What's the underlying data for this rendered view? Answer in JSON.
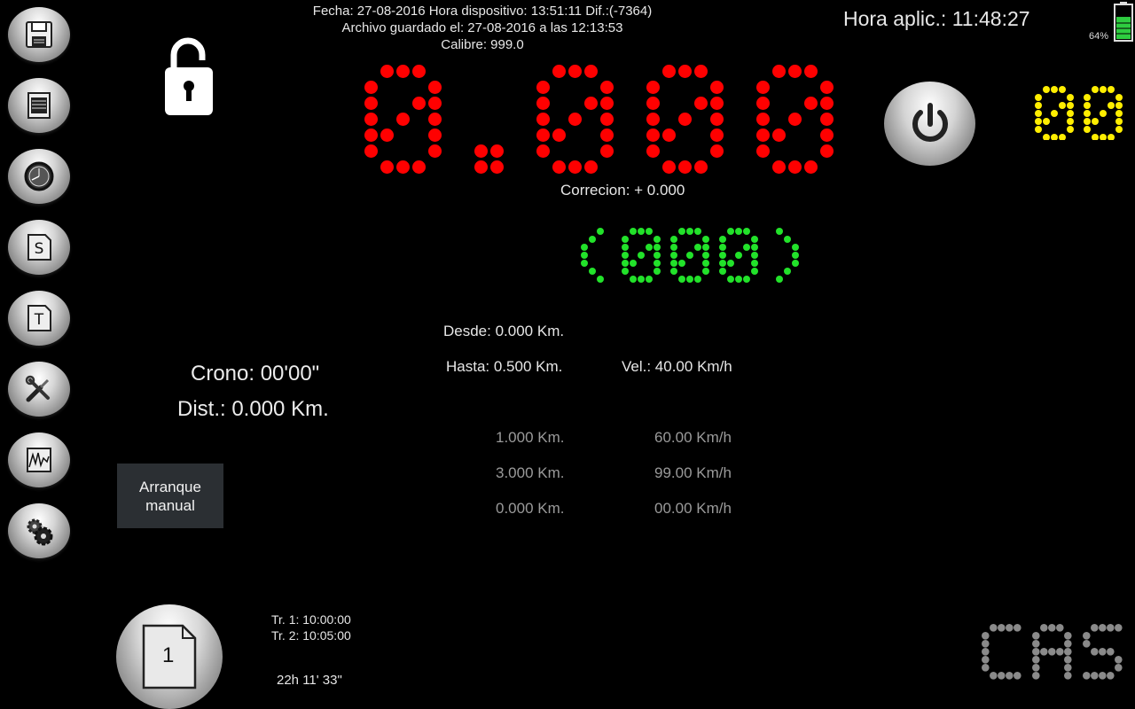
{
  "header": {
    "line1": "Fecha: 27-08-2016 Hora dispositivo: 13:51:11 Dif.:(-7364)",
    "line2": "Archivo guardado el: 27-08-2016 a las 12:13:53",
    "line3": "Calibre: 999.0"
  },
  "clock": "Hora aplic.: 11:48:27",
  "battery": {
    "percent": "64%",
    "level": 0.64,
    "color": "#2ecc40"
  },
  "sidebar": {
    "items": [
      {
        "name": "save",
        "icon": "floppy-icon"
      },
      {
        "name": "document",
        "icon": "document-icon"
      },
      {
        "name": "clock",
        "icon": "clock-icon"
      },
      {
        "name": "s-file",
        "icon": "s-file-icon",
        "letter": "S"
      },
      {
        "name": "t-file",
        "icon": "t-file-icon",
        "letter": "T"
      },
      {
        "name": "tools",
        "icon": "tools-icon"
      },
      {
        "name": "chart",
        "icon": "chart-icon"
      },
      {
        "name": "settings",
        "icon": "gears-icon"
      }
    ]
  },
  "displays": {
    "main_value": "0.000",
    "main_color": "#ff0000",
    "secondary_value": "(000)",
    "secondary_color": "#22e22a",
    "corner_value": "00",
    "corner_color": "#ffee00",
    "logo_text": "CAS",
    "logo_color": "#8a8a8a"
  },
  "correction": "Correcion: + 0.000",
  "segment": {
    "desde": "Desde: 0.000 Km.",
    "hasta": "Hasta: 0.500 Km.",
    "vel": "Vel.: 40.00 Km/h"
  },
  "upcoming": [
    {
      "km": "1.000 Km.",
      "speed": "60.00 Km/h"
    },
    {
      "km": "3.000 Km.",
      "speed": "99.00 Km/h"
    },
    {
      "km": "0.000 Km.",
      "speed": "00.00 Km/h"
    }
  ],
  "crono": "Crono: 00'00\"",
  "dist": "Dist.: 0.000 Km.",
  "manual_button": {
    "line1": "Arranque",
    "line2": "manual"
  },
  "page_button": {
    "number": "1"
  },
  "tramos": {
    "tr1": "Tr. 1: 10:00:00",
    "tr2": "Tr. 2: 10:05:00"
  },
  "elapsed": "22h 11' 33\""
}
